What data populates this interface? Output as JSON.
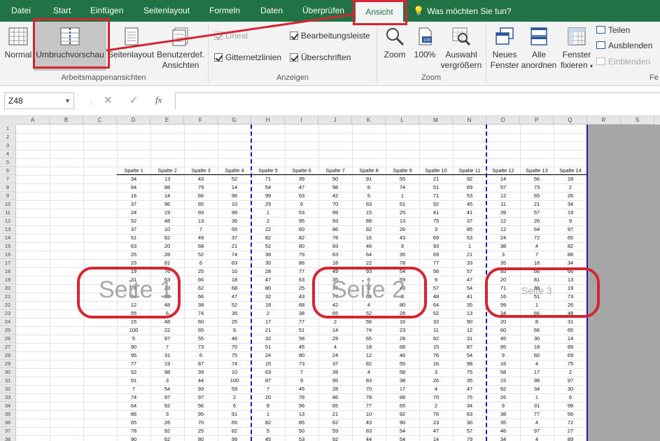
{
  "ribbon_tabs": [
    "Datei",
    "Start",
    "Einfügen",
    "Seitenlayout",
    "Formeln",
    "Daten",
    "Überprüfen",
    "Ansicht"
  ],
  "active_tab": "Ansicht",
  "tell_me": "Was möchten Sie tun?",
  "workbook_views": {
    "normal": "Normal",
    "page_break_preview": "Umbruchvorschau",
    "page_layout": "Seitenlayout",
    "custom_views_line1": "Benutzerdef.",
    "custom_views_line2": "Ansichten",
    "group_label": "Arbeitsmappenansichten"
  },
  "show": {
    "ruler": "Lineal",
    "gridlines": "Gitternetzlinien",
    "formula_bar": "Bearbeitungsleiste",
    "headings": "Überschriften",
    "group_label": "Anzeigen",
    "ruler_checked": true,
    "gridlines_checked": true,
    "formula_bar_checked": true,
    "headings_checked": true
  },
  "zoom": {
    "zoom": "Zoom",
    "hundred": "100%",
    "zoom_selection_line1": "Auswahl",
    "zoom_selection_line2": "vergrößern",
    "group_label": "Zoom"
  },
  "window": {
    "new_window_line1": "Neues",
    "new_window_line2": "Fenster",
    "arrange_line1": "Alle",
    "arrange_line2": "anordnen",
    "freeze_line1": "Fenster",
    "freeze_line2": "fixieren",
    "split": "Teilen",
    "hide": "Ausblenden",
    "unhide": "Einblenden",
    "group_label_partial": "Fe"
  },
  "formula_bar": {
    "name_box": "Z48",
    "cancel": "✕",
    "enter": "✓",
    "fx": "fx",
    "value": ""
  },
  "columns": [
    "A",
    "B",
    "C",
    "D",
    "E",
    "F",
    "G",
    "H",
    "I",
    "J",
    "K",
    "L",
    "M",
    "N",
    "O",
    "P",
    "Q",
    "R",
    "S"
  ],
  "rows": [
    1,
    2,
    3,
    4,
    5,
    6,
    7,
    8,
    9,
    10,
    11,
    12,
    13,
    14,
    15,
    16,
    17,
    18,
    19,
    20,
    21,
    22,
    23,
    24,
    25,
    26,
    27,
    28,
    29,
    30,
    31,
    32,
    33,
    34,
    35,
    36,
    37,
    38
  ],
  "table": {
    "headers": [
      "Spalte 1",
      "Spalte 2",
      "Spalte 3",
      "Spalte 4",
      "Spalte 5",
      "Spalte 6",
      "Spalte 7",
      "Spalte 8",
      "Spalte 9",
      "Spalte 10",
      "Spalte 11",
      "Spalte 12",
      "Spalte 13",
      "Spalte 14"
    ],
    "rows": [
      [
        34,
        13,
        43,
        52,
        71,
        39,
        50,
        91,
        55,
        21,
        92,
        14,
        56,
        18
      ],
      [
        94,
        88,
        79,
        14,
        54,
        47,
        98,
        8,
        74,
        51,
        69,
        57,
        73,
        2
      ],
      [
        16,
        14,
        66,
        96,
        99,
        63,
        42,
        5,
        1,
        71,
        53,
        12,
        65,
        26
      ],
      [
        37,
        96,
        65,
        10,
        29,
        6,
        70,
        63,
        51,
        92,
        45,
        11,
        21,
        34
      ],
      [
        24,
        19,
        69,
        99,
        1,
        53,
        99,
        15,
        25,
        41,
        41,
        39,
        57,
        19
      ],
      [
        52,
        48,
        13,
        36,
        2,
        95,
        93,
        88,
        13,
        75,
        37,
        12,
        26,
        9
      ],
      [
        37,
        10,
        7,
        55,
        22,
        60,
        86,
        82,
        26,
        3,
        85,
        12,
        64,
        97
      ],
      [
        51,
        62,
        49,
        37,
        82,
        82,
        78,
        16,
        43,
        69,
        53,
        24,
        72,
        65
      ],
      [
        63,
        20,
        68,
        21,
        52,
        80,
        93,
        46,
        9,
        93,
        1,
        38,
        4,
        82
      ],
      [
        25,
        28,
        52,
        74,
        38,
        79,
        63,
        64,
        35,
        69,
        21,
        3,
        7,
        88
      ],
      [
        23,
        81,
        6,
        63,
        30,
        86,
        18,
        22,
        78,
        77,
        33,
        35,
        18,
        34
      ],
      [
        19,
        76,
        25,
        10,
        28,
        77,
        49,
        93,
        54,
        56,
        57,
        93,
        66,
        66
      ],
      [
        31,
        63,
        66,
        18,
        47,
        63,
        35,
        6,
        59,
        9,
        47,
        20,
        81,
        13
      ],
      [
        78,
        23,
        62,
        68,
        80,
        25,
        37,
        8,
        49,
        57,
        54,
        71,
        88,
        19
      ],
      [
        84,
        88,
        66,
        47,
        32,
        43,
        77,
        65,
        8,
        48,
        41,
        16,
        51,
        73
      ],
      [
        12,
        48,
        38,
        52,
        18,
        68,
        42,
        4,
        80,
        64,
        35,
        99,
        1,
        26
      ],
      [
        55,
        6,
        74,
        35,
        2,
        38,
        65,
        52,
        28,
        52,
        13,
        34,
        66,
        48
      ],
      [
        15,
        48,
        60,
        25,
        17,
        77,
        2,
        56,
        16,
        32,
        90,
        20,
        8,
        31
      ],
      [
        100,
        22,
        65,
        9,
        21,
        51,
        14,
        74,
        23,
        11,
        12,
        60,
        66,
        65
      ],
      [
        5,
        97,
        55,
        46,
        32,
        58,
        29,
        65,
        28,
        92,
        31,
        45,
        30,
        14
      ],
      [
        90,
        7,
        73,
        70,
        51,
        45,
        4,
        18,
        68,
        15,
        87,
        95,
        18,
        89
      ],
      [
        95,
        31,
        6,
        75,
        24,
        80,
        24,
        12,
        46,
        76,
        54,
        9,
        60,
        69
      ],
      [
        77,
        19,
        87,
        74,
        15,
        73,
        37,
        82,
        55,
        16,
        98,
        16,
        4,
        75
      ],
      [
        52,
        98,
        39,
        10,
        63,
        7,
        39,
        4,
        58,
        3,
        75,
        58,
        17,
        2
      ],
      [
        91,
        3,
        44,
        100,
        87,
        9,
        95,
        83,
        38,
        26,
        35,
        15,
        98,
        97
      ],
      [
        7,
        54,
        93,
        59,
        7,
        45,
        28,
        70,
        17,
        4,
        47,
        92,
        34,
        30
      ],
      [
        74,
        97,
        97,
        2,
        20,
        78,
        86,
        78,
        88,
        70,
        75,
        26,
        1,
        6
      ],
      [
        64,
        92,
        56,
        6,
        8,
        56,
        65,
        77,
        65,
        2,
        34,
        9,
        31,
        99
      ],
      [
        86,
        3,
        95,
        91,
        1,
        13,
        21,
        10,
        92,
        76,
        63,
        38,
        77,
        56
      ],
      [
        65,
        26,
        70,
        65,
        82,
        85,
        62,
        43,
        90,
        23,
        30,
        35,
        4,
        72
      ],
      [
        78,
        92,
        25,
        82,
        5,
        50,
        59,
        83,
        54,
        47,
        57,
        46,
        97,
        27
      ],
      [
        90,
        62,
        80,
        99,
        45,
        53,
        92,
        44,
        54,
        14,
        79,
        34,
        4,
        89
      ]
    ]
  },
  "page_labels": {
    "page1": "Seite 1",
    "page2": "Seite 2",
    "page3": "Seite 3"
  },
  "colors": {
    "ribbon_green": "#217346",
    "annotation_red": "#d32630",
    "page_break_blue": "#1a1ab0"
  }
}
